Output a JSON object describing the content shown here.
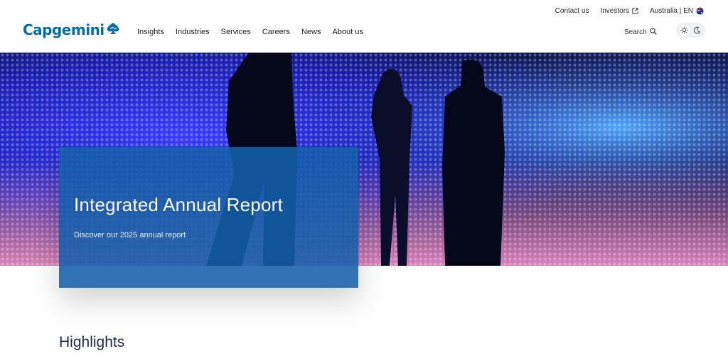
{
  "header": {
    "logo_text": "Capgemini",
    "utility_nav": {
      "contact": "Contact us",
      "investors": "Investors",
      "region": "Australia | EN"
    },
    "main_nav": [
      "Insights",
      "Industries",
      "Services",
      "Careers",
      "News",
      "About us"
    ],
    "search_label": "Search",
    "icons": {
      "external": "external-link-icon",
      "flag": "australia-flag-icon",
      "search": "search-icon",
      "light": "sun-icon",
      "dark": "moon-icon"
    }
  },
  "hero": {
    "title": "Integrated Annual Report",
    "subtitle": "Discover our 2025 annual report"
  },
  "section": {
    "heading": "Highlights"
  },
  "colors": {
    "brand": "#0070ad",
    "card": "#145faa",
    "text": "#1f2a44"
  }
}
